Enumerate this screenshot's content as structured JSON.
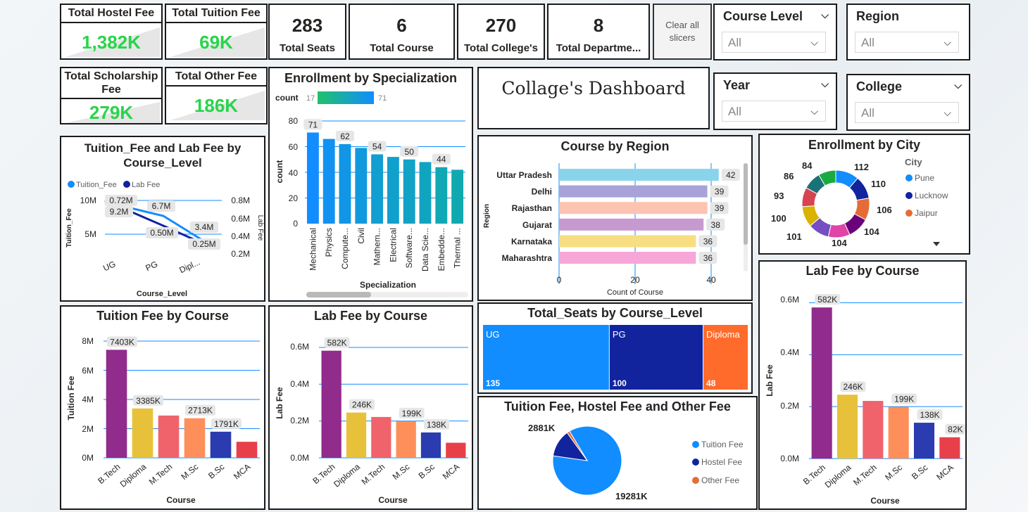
{
  "kpis": {
    "hostel_fee": {
      "label": "Total Hostel Fee",
      "value": "1,382K"
    },
    "tuition_fee": {
      "label": "Total Tuition Fee",
      "value": "69K"
    },
    "scholarship_fee": {
      "label": "Total Scholarship Fee",
      "value": "279K"
    },
    "other_fee": {
      "label": "Total Other Fee",
      "value": "186K"
    },
    "seats": {
      "value": "283",
      "label": "Total Seats"
    },
    "course": {
      "value": "6",
      "label": "Total Course"
    },
    "colleges": {
      "value": "270",
      "label": "Total College's"
    },
    "departments": {
      "value": "8",
      "label": "Total Departme..."
    }
  },
  "clear_button": "Clear all slicers",
  "title": "Collage's Dashboard",
  "slicers": {
    "course_level": {
      "label": "Course Level",
      "value": "All"
    },
    "region": {
      "label": "Region",
      "value": "All"
    },
    "year": {
      "label": "Year",
      "value": "All"
    },
    "college": {
      "label": "College",
      "value": "All"
    }
  },
  "colors": {
    "accent": "#118dff",
    "kpi_green": "#29d44a",
    "navy": "#12239e",
    "orange": "#e66c37"
  },
  "charts": {
    "tuition_lab_level": {
      "title": "Tuition_Fee and Lab Fee by Course_Level",
      "legend": [
        "Tuition_Fee",
        "Lab Fee"
      ],
      "xlabel": "Course_Level",
      "ylabel": "Tuition_Fee",
      "y2label": "Lab Fee",
      "yticks": [
        "10M",
        "5M"
      ],
      "y2ticks": [
        "0.8M",
        "0.6M",
        "0.4M",
        "0.2M"
      ],
      "categories": [
        "UG",
        "PG",
        "Dipl..."
      ],
      "labels": [
        "0.72M",
        "9.2M",
        "6.7M",
        "0.50M",
        "3.4M",
        "0.25M"
      ]
    },
    "enroll_spec": {
      "title": "Enrollment by Specialization",
      "legend_label": "count",
      "legend_min": "17",
      "legend_max": "71",
      "xlabel": "Specialization",
      "ylabel": "count",
      "yticks": [
        "80",
        "60",
        "40",
        "20",
        "0"
      ],
      "categories": [
        "Mechanical",
        "Physics",
        "Compute...",
        "Civil",
        "Mathem...",
        "Electrical",
        "Software...",
        "Data Scie...",
        "Embedde...",
        "Thermal ..."
      ],
      "labels": [
        "71",
        "62",
        "54",
        "50",
        "44"
      ]
    },
    "course_region": {
      "title": "Course by Region",
      "ylabel": "Region",
      "xlabel": "Count of Course",
      "categories": [
        "Uttar Pradesh",
        "Delhi",
        "Rajasthan",
        "Gujarat",
        "Karnataka",
        "Maharashtra"
      ],
      "labels": [
        "42",
        "39",
        "39",
        "38",
        "36",
        "36"
      ],
      "xticks": [
        "0",
        "20",
        "40"
      ]
    },
    "enroll_city": {
      "title": "Enrollment by City",
      "legend_title": "City",
      "legend": [
        "Pune",
        "Lucknow",
        "Jaipur"
      ],
      "labels": [
        "112",
        "110",
        "106",
        "104",
        "104",
        "101",
        "100",
        "93",
        "86",
        "84"
      ]
    },
    "seats_level": {
      "title": "Total_Seats by Course_Level",
      "names": [
        "UG",
        "PG",
        "Diploma"
      ],
      "labels": [
        "135",
        "100",
        "48"
      ]
    },
    "fee_pie": {
      "title": "Tuition Fee, Hostel Fee and Other Fee",
      "legend": [
        "Tuition Fee",
        "Hostel Fee",
        "Other Fee"
      ],
      "labels": [
        "2881K",
        "19281K"
      ]
    },
    "tuition_course": {
      "title": "Tuition Fee by Course",
      "xlabel": "Course",
      "ylabel": "Tuition Fee",
      "yticks": [
        "8M",
        "6M",
        "4M",
        "2M",
        "0M"
      ],
      "categories": [
        "B.Tech",
        "Diploma",
        "M.Tech",
        "M.Sc",
        "B.Sc",
        "MCA"
      ],
      "labels": [
        "7403K",
        "3385K",
        "2713K",
        "1791K"
      ]
    },
    "lab_course": {
      "title": "Lab Fee by Course",
      "xlabel": "Course",
      "ylabel": "Lab Fee",
      "yticks": [
        "0.6M",
        "0.4M",
        "0.2M",
        "0.0M"
      ],
      "categories": [
        "B.Tech",
        "Diploma",
        "M.Tech",
        "M.Sc",
        "B.Sc",
        "MCA"
      ],
      "labels": [
        "582K",
        "246K",
        "199K",
        "138K"
      ]
    },
    "lab_course_2": {
      "title": "Lab Fee by Course",
      "xlabel": "Course",
      "ylabel": "Lab Fee",
      "yticks": [
        "0.6M",
        "0.4M",
        "0.2M",
        "0.0M"
      ],
      "categories": [
        "B.Tech",
        "Diploma",
        "M.Tech",
        "M.Sc",
        "B.Sc",
        "MCA"
      ],
      "labels": [
        "582K",
        "246K",
        "199K",
        "138K",
        "82K"
      ]
    }
  },
  "chart_data": [
    {
      "type": "line",
      "title": "Tuition_Fee and Lab Fee by Course_Level",
      "xlabel": "Course_Level",
      "ylabel": "Tuition_Fee",
      "categories": [
        "UG",
        "PG",
        "Dipl..."
      ],
      "series": [
        {
          "name": "Tuition_Fee",
          "values": [
            9.2,
            6.7,
            3.4
          ],
          "unit": "M"
        },
        {
          "name": "Lab Fee",
          "values": [
            0.72,
            0.5,
            0.25
          ],
          "unit": "M"
        }
      ],
      "ylim": [
        0,
        10
      ],
      "y2lim": [
        0.2,
        0.8
      ],
      "legend": "top-left"
    },
    {
      "type": "bar",
      "title": "Enrollment by Specialization",
      "xlabel": "Specialization",
      "ylabel": "count",
      "categories": [
        "Mechanical",
        "Physics",
        "Compute...",
        "Civil",
        "Mathem...",
        "Electrical",
        "Software...",
        "Data Scie...",
        "Embedde...",
        "Thermal ..."
      ],
      "values": [
        71,
        66,
        62,
        59,
        54,
        52,
        50,
        48,
        44,
        42
      ],
      "ylim": [
        0,
        80
      ]
    },
    {
      "type": "bar",
      "title": "Course by Region",
      "xlabel": "Count of Course",
      "ylabel": "Region",
      "orientation": "horizontal",
      "categories": [
        "Uttar Pradesh",
        "Delhi",
        "Rajasthan",
        "Gujarat",
        "Karnataka",
        "Maharashtra"
      ],
      "values": [
        42,
        39,
        39,
        38,
        36,
        36
      ],
      "xlim": [
        0,
        50
      ]
    },
    {
      "type": "pie",
      "title": "Enrollment by City",
      "donut": true,
      "values": [
        112,
        110,
        106,
        104,
        104,
        101,
        100,
        93,
        86,
        84
      ]
    },
    {
      "type": "bar",
      "title": "Total_Seats by Course_Level",
      "categories": [
        "UG",
        "PG",
        "Diploma"
      ],
      "values": [
        135,
        100,
        48
      ]
    },
    {
      "type": "pie",
      "title": "Tuition Fee, Hostel Fee and Other Fee",
      "categories": [
        "Tuition Fee",
        "Hostel Fee",
        "Other Fee"
      ],
      "values": [
        19281,
        2881,
        300
      ],
      "unit": "K"
    },
    {
      "type": "bar",
      "title": "Tuition Fee by Course",
      "xlabel": "Course",
      "ylabel": "Tuition Fee",
      "categories": [
        "B.Tech",
        "Diploma",
        "M.Tech",
        "M.Sc",
        "B.Sc",
        "MCA"
      ],
      "values": [
        7403,
        3385,
        2900,
        2713,
        1791,
        1100
      ],
      "unit": "K",
      "ylim": [
        0,
        8000
      ]
    },
    {
      "type": "bar",
      "title": "Lab Fee by Course",
      "xlabel": "Course",
      "ylabel": "Lab Fee",
      "categories": [
        "B.Tech",
        "Diploma",
        "M.Tech",
        "M.Sc",
        "B.Sc",
        "MCA"
      ],
      "values": [
        582,
        246,
        222,
        199,
        138,
        82
      ],
      "unit": "K",
      "ylim": [
        0,
        680
      ]
    }
  ]
}
